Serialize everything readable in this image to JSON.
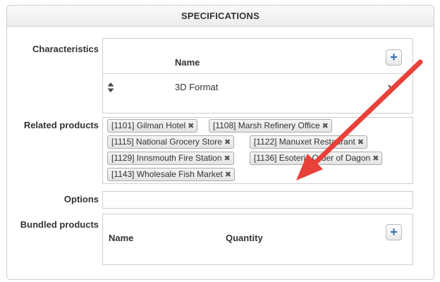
{
  "header": {
    "title": "SPECIFICATIONS"
  },
  "characteristics": {
    "label": "Characteristics",
    "column_name": "Name",
    "add_glyph": "+",
    "rows": [
      {
        "name": "3D Format"
      }
    ]
  },
  "related_products": {
    "label": "Related products",
    "remove_glyph": "✖",
    "items": [
      "[1101] Gilman Hotel",
      "[1108] Marsh Refinery Office",
      "[1115] National Grocery Store",
      "[1122] Manuxet Restaurant",
      "[1129] Innsmouth Fire Station",
      "[1136] Esoteric Order of Dagon",
      "[1143] Wholesale Fish Market"
    ]
  },
  "options": {
    "label": "Options",
    "value": ""
  },
  "bundled_products": {
    "label": "Bundled products",
    "column_name": "Name",
    "column_quantity": "Quantity",
    "add_glyph": "+"
  },
  "annotation": {
    "arrow_color": "#e8413a"
  }
}
